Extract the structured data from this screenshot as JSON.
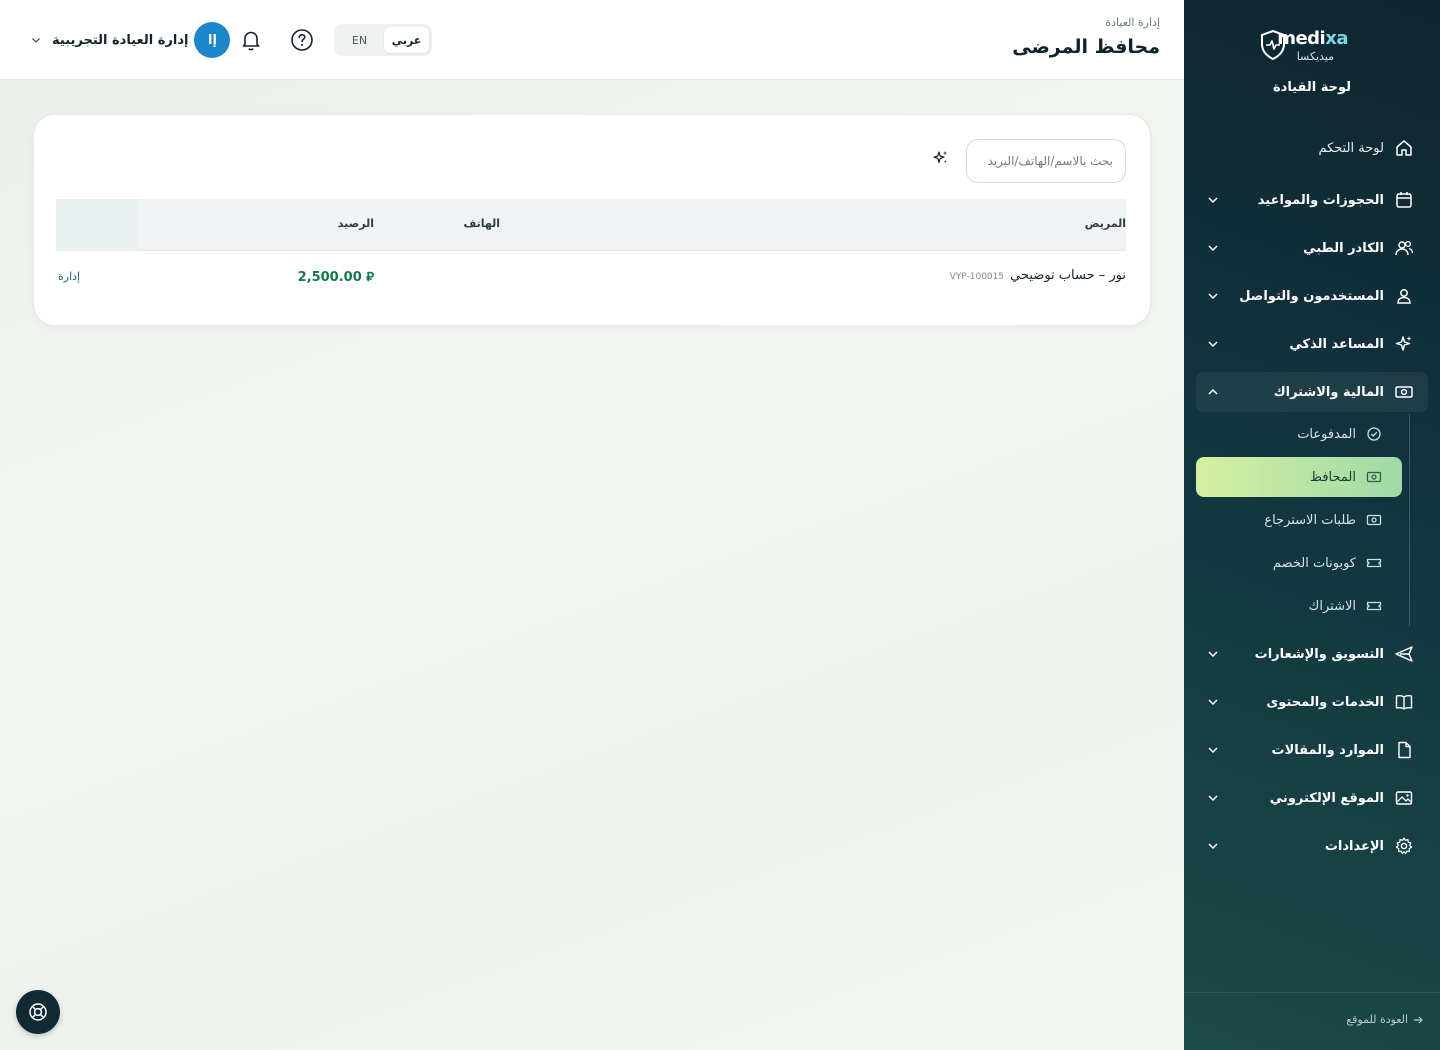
{
  "brand": {
    "name_prefix": "medi",
    "name_accent": "xa",
    "name_ar": "ميديكسا",
    "dashboard_title": "لوحة القيادة"
  },
  "sidebar": {
    "items": [
      {
        "label": "لوحة التحكم",
        "icon": "home-icon"
      },
      {
        "label": "الحجوزات والمواعيد",
        "icon": "calendar-icon"
      },
      {
        "label": "الكادر الطبي",
        "icon": "users-icon"
      },
      {
        "label": "المستخدمون والتواصل",
        "icon": "user-icon"
      },
      {
        "label": "المساعد الذكي",
        "icon": "sparkles-icon"
      },
      {
        "label": "المالية والاشتراك",
        "icon": "money-icon",
        "expanded": true
      },
      {
        "label": "التسويق والإشعارات",
        "icon": "send-icon"
      },
      {
        "label": "الخدمات والمحتوى",
        "icon": "book-icon"
      },
      {
        "label": "الموارد والمقالات",
        "icon": "file-icon"
      },
      {
        "label": "الموقع الإلكتروني",
        "icon": "image-icon"
      },
      {
        "label": "الإعدادات",
        "icon": "gear-icon"
      }
    ],
    "finance_sub": [
      {
        "label": "المدفوعات",
        "icon": "check-circle-icon"
      },
      {
        "label": "المحافظ",
        "icon": "wallet-icon",
        "active": true
      },
      {
        "label": "طلبات الاسترجاع",
        "icon": "refund-icon"
      },
      {
        "label": "كوبونات الخصم",
        "icon": "ticket-icon"
      },
      {
        "label": "الاشتراك",
        "icon": "ticket-icon"
      }
    ],
    "back_link": "العودة للموقع"
  },
  "header": {
    "breadcrumb": "إدارة العيادة",
    "title": "محافظ المرضى",
    "lang_ar": "عربي",
    "lang_en": "EN",
    "user_initials": "إا",
    "user_name": "إدارة العيادة التجريبية"
  },
  "main": {
    "search_placeholder": "بحث بالاسم/الهاتف/البريد",
    "columns": {
      "patient": "المريض",
      "phone": "الهاتف",
      "balance": "الرصيد"
    },
    "rows": [
      {
        "name": "نور – حساب توضيحي",
        "code": "VYP-100015",
        "phone": "",
        "balance": "2,500.00 ⃁",
        "action": "إدارة"
      }
    ]
  },
  "colors": {
    "sidebar_bg": "#123440",
    "active_item": "#c7ebb0",
    "avatar": "#1b86c8",
    "balance_green": "#0f7a4a"
  }
}
